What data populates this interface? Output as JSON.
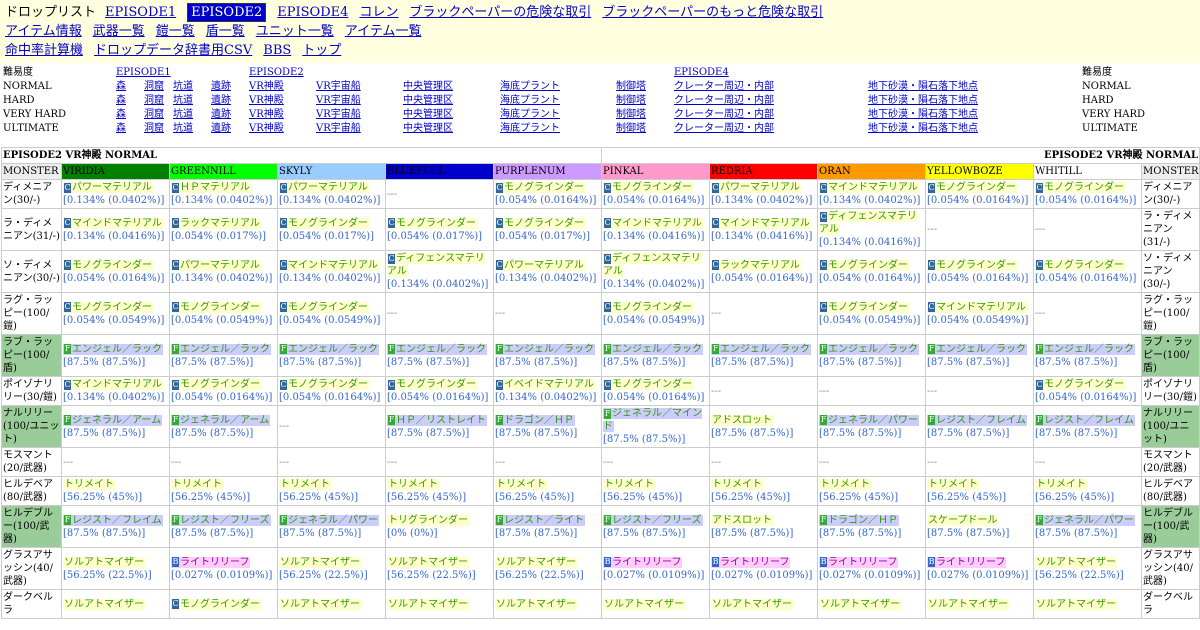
{
  "nav": {
    "title": "ドロップリスト",
    "row1": [
      "EPISODE1",
      "EPISODE2",
      "EPISODE4",
      "コレン",
      "ブラックペーパーの危険な取引",
      "ブラックペーパーのもっと危険な取引"
    ],
    "row2": [
      "アイテム情報",
      "武器一覧",
      "鎧一覧",
      "盾一覧",
      "ユニット一覧",
      "アイテム一覧"
    ],
    "row3": [
      "命中率計算機",
      "ドロップデータ辞書用CSV",
      "BBS",
      "トップ"
    ],
    "selected": "EPISODE2"
  },
  "difficulty": {
    "header_label": "難易度",
    "ep1": "EPISODE1",
    "ep2": "EPISODE2",
    "ep4": "EPISODE4",
    "levels": [
      "NORMAL",
      "HARD",
      "VERY HARD",
      "ULTIMATE"
    ],
    "areas": [
      "森",
      "洞窟",
      "坑道",
      "遺跡",
      "VR神殿",
      "VR宇宙船",
      "中央管理区",
      "海底プラント",
      "制御塔",
      "クレーター周辺・内部",
      "地下砂漠・隕石落下地点"
    ]
  },
  "table": {
    "title_left": "EPISODE2 VR神殿 NORMAL",
    "title_right": "EPISODE2 VR神殿 NORMAL",
    "monster_label": "MONSTER",
    "ids": [
      {
        "name": "VIRIDIA",
        "color": "#008000",
        "text": "#000"
      },
      {
        "name": "GREENNILL",
        "color": "#00ff00",
        "text": "#000"
      },
      {
        "name": "SKYLY",
        "color": "#99ccff",
        "text": "#000"
      },
      {
        "name": "BLUEFULL",
        "color": "#0000cc",
        "text": "#000"
      },
      {
        "name": "PURPLENUM",
        "color": "#cc99ff",
        "text": "#000"
      },
      {
        "name": "PINKAL",
        "color": "#ff99cc",
        "text": "#000"
      },
      {
        "name": "REDRIA",
        "color": "#ff0000",
        "text": "#000"
      },
      {
        "name": "ORAN",
        "color": "#ff9900",
        "text": "#000"
      },
      {
        "name": "YELLOWBOZE",
        "color": "#ffff00",
        "text": "#000"
      },
      {
        "name": "WHITILL",
        "color": "#ffffff",
        "text": "#000"
      }
    ],
    "rows": [
      {
        "monster": "ディメニアン(30/-)",
        "hl": false,
        "cells": [
          {
            "t": "C",
            "n": "パワーマテリアル",
            "r": "[0.134% (0.0402%)]"
          },
          {
            "t": "C",
            "n": "ＨＰマテリアル",
            "r": "[0.134% (0.0402%)]"
          },
          {
            "t": "C",
            "n": "パワーマテリアル",
            "r": "[0.134% (0.0402%)]"
          },
          null,
          {
            "t": "C",
            "n": "モノグラインダー",
            "r": "[0.054% (0.0164%)]"
          },
          {
            "t": "C",
            "n": "モノグラインダー",
            "r": "[0.054% (0.0164%)]"
          },
          {
            "t": "C",
            "n": "パワーマテリアル",
            "r": "[0.134% (0.0402%)]"
          },
          {
            "t": "C",
            "n": "マインドマテリアル",
            "r": "[0.134% (0.0402%)]"
          },
          {
            "t": "C",
            "n": "モノグラインダー",
            "r": "[0.054% (0.0164%)]"
          },
          {
            "t": "C",
            "n": "モノグラインダー",
            "r": "[0.054% (0.0164%)]"
          }
        ]
      },
      {
        "monster": "ラ・ディメニアン(31/-)",
        "hl": false,
        "cells": [
          {
            "t": "C",
            "n": "マインドマテリアル",
            "r": "[0.134% (0.0416%)]"
          },
          {
            "t": "C",
            "n": "ラックマテリアル",
            "r": "[0.054% (0.017%)]"
          },
          {
            "t": "C",
            "n": "モノグラインダー",
            "r": "[0.054% (0.017%)]"
          },
          {
            "t": "C",
            "n": "モノグラインダー",
            "r": "[0.054% (0.017%)]"
          },
          {
            "t": "C",
            "n": "モノグラインダー",
            "r": "[0.054% (0.017%)]"
          },
          {
            "t": "C",
            "n": "マインドマテリアル",
            "r": "[0.134% (0.0416%)]"
          },
          {
            "t": "C",
            "n": "マインドマテリアル",
            "r": "[0.134% (0.0416%)]"
          },
          {
            "t": "C",
            "n": "ディフェンスマテリアル",
            "r": "[0.134% (0.0416%)]"
          },
          null,
          null
        ]
      },
      {
        "monster": "ソ・ディメニアン(30/-)",
        "hl": false,
        "cells": [
          {
            "t": "C",
            "n": "モノグラインダー",
            "r": "[0.054% (0.0164%)]"
          },
          {
            "t": "C",
            "n": "パワーマテリアル",
            "r": "[0.134% (0.0402%)]"
          },
          {
            "t": "C",
            "n": "マインドマテリアル",
            "r": "[0.134% (0.0402%)]"
          },
          {
            "t": "C",
            "n": "ディフェンスマテリアル",
            "r": "[0.134% (0.0402%)]"
          },
          {
            "t": "C",
            "n": "パワーマテリアル",
            "r": "[0.134% (0.0402%)]"
          },
          {
            "t": "C",
            "n": "ディフェンスマテリアル",
            "r": "[0.134% (0.0402%)]"
          },
          {
            "t": "C",
            "n": "ラックマテリアル",
            "r": "[0.054% (0.0164%)]"
          },
          {
            "t": "C",
            "n": "モノグラインダー",
            "r": "[0.054% (0.0164%)]"
          },
          {
            "t": "C",
            "n": "モノグラインダー",
            "r": "[0.054% (0.0164%)]"
          },
          {
            "t": "C",
            "n": "モノグラインダー",
            "r": "[0.054% (0.0164%)]"
          }
        ]
      },
      {
        "monster": "ラグ・ラッピー(100/鎧)",
        "hl": false,
        "cells": [
          {
            "t": "C",
            "n": "モノグラインダー",
            "r": "[0.054% (0.0549%)]"
          },
          {
            "t": "C",
            "n": "モノグラインダー",
            "r": "[0.054% (0.0549%)]"
          },
          {
            "t": "C",
            "n": "モノグラインダー",
            "r": "[0.054% (0.0549%)]"
          },
          null,
          null,
          {
            "t": "C",
            "n": "モノグラインダー",
            "r": "[0.054% (0.0549%)]"
          },
          null,
          {
            "t": "C",
            "n": "モノグラインダー",
            "r": "[0.054% (0.0549%)]"
          },
          {
            "t": "C",
            "n": "マインドマテリアル",
            "r": "[0.054% (0.0549%)]"
          },
          null
        ]
      },
      {
        "monster": "ラブ・ラッピー(100/盾)",
        "hl": true,
        "cells": [
          {
            "t": "F",
            "n": "エンジェル／ラック",
            "r": "[87.5% (87.5%)]"
          },
          {
            "t": "F",
            "n": "エンジェル／ラック",
            "r": "[87.5% (87.5%)]"
          },
          {
            "t": "F",
            "n": "エンジェル／ラック",
            "r": "[87.5% (87.5%)]"
          },
          {
            "t": "F",
            "n": "エンジェル／ラック",
            "r": "[87.5% (87.5%)]"
          },
          {
            "t": "F",
            "n": "エンジェル／ラック",
            "r": "[87.5% (87.5%)]"
          },
          {
            "t": "F",
            "n": "エンジェル／ラック",
            "r": "[87.5% (87.5%)]"
          },
          {
            "t": "F",
            "n": "エンジェル／ラック",
            "r": "[87.5% (87.5%)]"
          },
          {
            "t": "F",
            "n": "エンジェル／ラック",
            "r": "[87.5% (87.5%)]"
          },
          {
            "t": "F",
            "n": "エンジェル／ラック",
            "r": "[87.5% (87.5%)]"
          },
          {
            "t": "F",
            "n": "エンジェル／ラック",
            "r": "[87.5% (87.5%)]"
          }
        ]
      },
      {
        "monster": "ポイゾナリリー(30/鎧)",
        "hl": false,
        "cells": [
          {
            "t": "C",
            "n": "マインドマテリアル",
            "r": "[0.134% (0.0402%)]"
          },
          {
            "t": "C",
            "n": "モノグラインダー",
            "r": "[0.054% (0.0164%)]"
          },
          {
            "t": "C",
            "n": "モノグラインダー",
            "r": "[0.054% (0.0164%)]"
          },
          {
            "t": "C",
            "n": "モノグラインダー",
            "r": "[0.054% (0.0164%)]"
          },
          {
            "t": "C",
            "n": "イベイドマテリアル",
            "r": "[0.134% (0.0402%)]"
          },
          {
            "t": "C",
            "n": "モノグラインダー",
            "r": "[0.054% (0.0164%)]"
          },
          null,
          null,
          null,
          {
            "t": "C",
            "n": "モノグラインダー",
            "r": "[0.054% (0.0164%)]"
          }
        ]
      },
      {
        "monster": "ナルリリー(100/ユニット)",
        "hl": true,
        "cells": [
          {
            "t": "F",
            "n": "ジェネラル／アーム",
            "r": "[87.5% (87.5%)]"
          },
          {
            "t": "F",
            "n": "ジェネラル／アーム",
            "r": "[87.5% (87.5%)]"
          },
          null,
          {
            "t": "F",
            "n": "ＨＰ／リストレイト",
            "r": "[87.5% (87.5%)]"
          },
          {
            "t": "F",
            "n": "ドラゴン／ＨＰ",
            "r": "[87.5% (87.5%)]"
          },
          {
            "t": "F",
            "n": "ジェネラル／マインド",
            "r": "[87.5% (87.5%)]"
          },
          {
            "t": "N",
            "n": "アドスロット",
            "r": "[87.5% (87.5%)]"
          },
          {
            "t": "F",
            "n": "ジェネラル／パワー",
            "r": "[87.5% (87.5%)]"
          },
          {
            "t": "F",
            "n": "レジスト／フレイム",
            "r": "[87.5% (87.5%)]"
          },
          {
            "t": "F",
            "n": "レジスト／フレイム",
            "r": "[87.5% (87.5%)]"
          }
        ]
      },
      {
        "monster": "モスマント(20/武器)",
        "hl": false,
        "cells": [
          null,
          null,
          null,
          null,
          null,
          null,
          null,
          null,
          null,
          null
        ]
      },
      {
        "monster": "ヒルデベア(80/武器)",
        "hl": false,
        "cells": [
          {
            "t": "N",
            "n": "トリメイト",
            "r": "[56.25% (45%)]"
          },
          {
            "t": "N",
            "n": "トリメイト",
            "r": "[56.25% (45%)]"
          },
          {
            "t": "N",
            "n": "トリメイト",
            "r": "[56.25% (45%)]"
          },
          {
            "t": "N",
            "n": "トリメイト",
            "r": "[56.25% (45%)]"
          },
          {
            "t": "N",
            "n": "トリメイト",
            "r": "[56.25% (45%)]"
          },
          {
            "t": "N",
            "n": "トリメイト",
            "r": "[56.25% (45%)]"
          },
          {
            "t": "N",
            "n": "トリメイト",
            "r": "[56.25% (45%)]"
          },
          {
            "t": "N",
            "n": "トリメイト",
            "r": "[56.25% (45%)]"
          },
          {
            "t": "N",
            "n": "トリメイト",
            "r": "[56.25% (45%)]"
          },
          {
            "t": "N",
            "n": "トリメイト",
            "r": "[56.25% (45%)]"
          }
        ]
      },
      {
        "monster": "ヒルデブルー(100/武器)",
        "hl": true,
        "cells": [
          {
            "t": "F",
            "n": "レジスト／フレイム",
            "r": "[87.5% (87.5%)]"
          },
          {
            "t": "F",
            "n": "レジスト／フリーズ",
            "r": "[87.5% (87.5%)]"
          },
          {
            "t": "F",
            "n": "ジェネラル／パワー",
            "r": "[87.5% (87.5%)]"
          },
          {
            "t": "X",
            "n": "トリグラインダー",
            "r": "[0% (0%)]"
          },
          {
            "t": "F",
            "n": "レジスト／ライト",
            "r": "[87.5% (87.5%)]"
          },
          {
            "t": "F",
            "n": "レジスト／フリーズ",
            "r": "[87.5% (87.5%)]"
          },
          {
            "t": "N",
            "n": "アドスロット",
            "r": "[87.5% (87.5%)]"
          },
          {
            "t": "F",
            "n": "ドラゴン／ＨＰ",
            "r": "[87.5% (87.5%)]"
          },
          {
            "t": "N",
            "n": "スケープドール",
            "r": "[87.5% (87.5%)]"
          },
          {
            "t": "F",
            "n": "ジェネラル／パワー",
            "r": "[87.5% (87.5%)]"
          }
        ]
      },
      {
        "monster": "グラスアサッシン(40/武器)",
        "hl": false,
        "cells": [
          {
            "t": "N",
            "n": "ソルアトマイザー",
            "r": "[56.25% (22.5%)]"
          },
          {
            "t": "B",
            "n": "ライトリリーフ",
            "r": "[0.027% (0.0109%)]"
          },
          {
            "t": "N",
            "n": "ソルアトマイザー",
            "r": "[56.25% (22.5%)]"
          },
          {
            "t": "N",
            "n": "ソルアトマイザー",
            "r": "[56.25% (22.5%)]"
          },
          {
            "t": "N",
            "n": "ソルアトマイザー",
            "r": "[56.25% (22.5%)]"
          },
          {
            "t": "B",
            "n": "ライトリリーフ",
            "r": "[0.027% (0.0109%)]"
          },
          {
            "t": "B",
            "n": "ライトリリーフ",
            "r": "[0.027% (0.0109%)]"
          },
          {
            "t": "B",
            "n": "ライトリリーフ",
            "r": "[0.027% (0.0109%)]"
          },
          {
            "t": "B",
            "n": "ライトリリーフ",
            "r": "[0.027% (0.0109%)]"
          },
          {
            "t": "N",
            "n": "ソルアトマイザー",
            "r": "[56.25% (22.5%)]"
          }
        ]
      },
      {
        "monster": "ダークベルラ",
        "hl": false,
        "cells": [
          {
            "t": "N",
            "n": "ソルアトマイザー",
            "r": ""
          },
          {
            "t": "C",
            "n": "モノグラインダー",
            "r": ""
          },
          {
            "t": "N",
            "n": "ソルアトマイザー",
            "r": ""
          },
          {
            "t": "N",
            "n": "ソルアトマイザー",
            "r": ""
          },
          {
            "t": "N",
            "n": "ソルアトマイザー",
            "r": ""
          },
          {
            "t": "N",
            "n": "ソルアトマイザー",
            "r": ""
          },
          {
            "t": "N",
            "n": "ソルアトマイザー",
            "r": ""
          },
          {
            "t": "N",
            "n": "ソルアトマイザー",
            "r": ""
          },
          {
            "t": "N",
            "n": "ソルアトマイザー",
            "r": ""
          },
          {
            "t": "N",
            "n": "ソルアトマイザー",
            "r": ""
          }
        ]
      }
    ],
    "empty": "---"
  }
}
